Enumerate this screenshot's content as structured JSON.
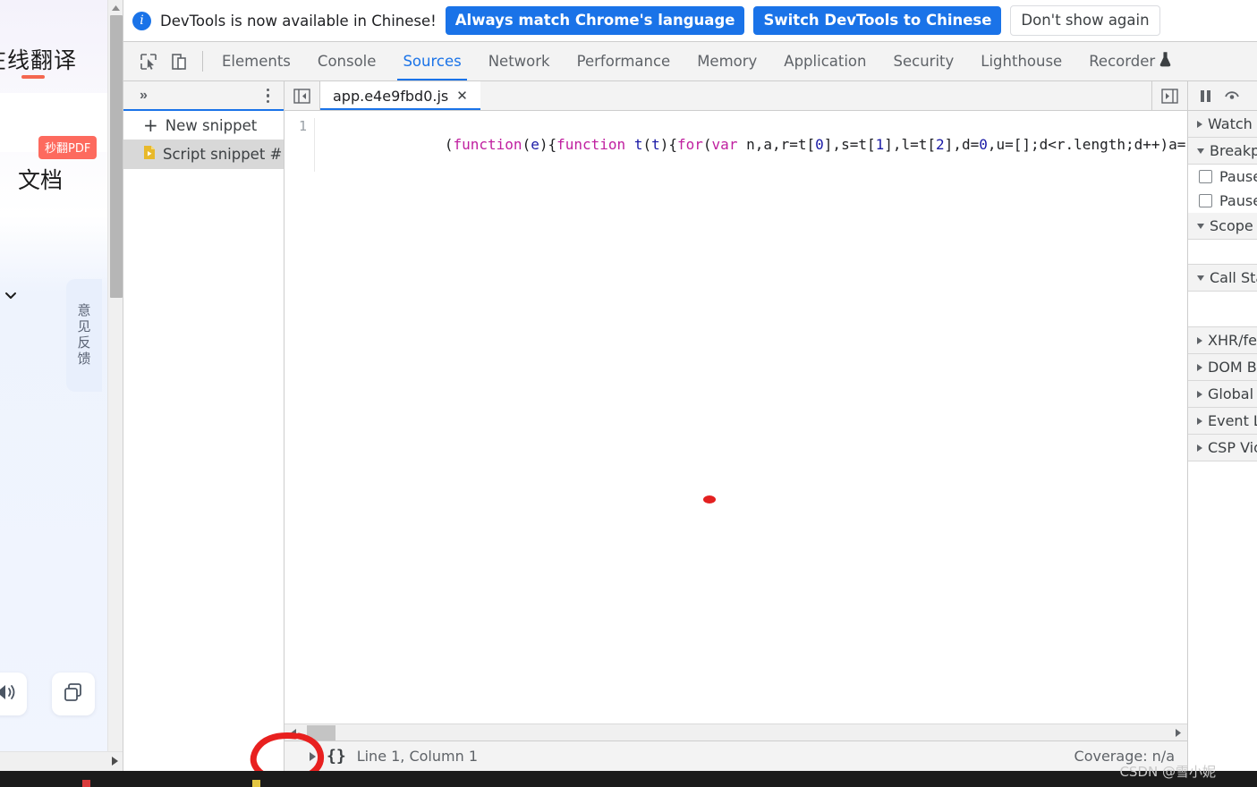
{
  "page_behind": {
    "title": "在线翻译",
    "badge": "秒翻PDF",
    "doc_label": "文档",
    "feedback_label": "意见反馈",
    "speaker_icon": "speaker-icon",
    "copy_icon": "copy-icon",
    "chevron_icon": "chevron-down-icon"
  },
  "devtools": {
    "banner": {
      "info_icon": "info-icon",
      "message": "DevTools is now available in Chinese!",
      "primary_action": "Always match Chrome's language",
      "secondary_action": "Switch DevTools to Chinese",
      "dismiss_action": "Don't show again"
    },
    "toolbar_icons": [
      {
        "name": "inspect-element-icon"
      },
      {
        "name": "device-toolbar-icon"
      }
    ],
    "tabs": [
      {
        "label": "Elements",
        "active": false
      },
      {
        "label": "Console",
        "active": false
      },
      {
        "label": "Sources",
        "active": true
      },
      {
        "label": "Network",
        "active": false
      },
      {
        "label": "Performance",
        "active": false
      },
      {
        "label": "Memory",
        "active": false
      },
      {
        "label": "Application",
        "active": false
      },
      {
        "label": "Security",
        "active": false
      },
      {
        "label": "Lighthouse",
        "active": false
      },
      {
        "label": "Recorder",
        "active": false,
        "icon": "flask-experiment-icon"
      }
    ],
    "navigator": {
      "more_tabs_icon": "chevron-double-right-icon",
      "menu_icon": "kebab-menu-icon",
      "new_snippet": "New snippet",
      "snippet_item": "Script snippet #",
      "snippet_file_icon": "script-file-icon"
    },
    "editor": {
      "sidebar_toggle_icon": "collapse-sidebar-icon",
      "right_toggle_icon": "expand-sidebar-icon",
      "file_tab": "app.e4e9fbd0.js",
      "close_icon": "close-icon",
      "line_number": "1",
      "code_tokens": [
        {
          "t": "(",
          "c": "plain"
        },
        {
          "t": "function",
          "c": "kw"
        },
        {
          "t": "(",
          "c": "plain"
        },
        {
          "t": "e",
          "c": "var"
        },
        {
          "t": "){",
          "c": "plain"
        },
        {
          "t": "function",
          "c": "kw"
        },
        {
          "t": " ",
          "c": "plain"
        },
        {
          "t": "t",
          "c": "var"
        },
        {
          "t": "(",
          "c": "plain"
        },
        {
          "t": "t",
          "c": "var"
        },
        {
          "t": "){",
          "c": "plain"
        },
        {
          "t": "for",
          "c": "kw"
        },
        {
          "t": "(",
          "c": "plain"
        },
        {
          "t": "var",
          "c": "kw"
        },
        {
          "t": " n,a,r=t[",
          "c": "plain"
        },
        {
          "t": "0",
          "c": "num"
        },
        {
          "t": "],s=t[",
          "c": "plain"
        },
        {
          "t": "1",
          "c": "num"
        },
        {
          "t": "],l=t[",
          "c": "plain"
        },
        {
          "t": "2",
          "c": "num"
        },
        {
          "t": "],d=",
          "c": "plain"
        },
        {
          "t": "0",
          "c": "num"
        },
        {
          "t": ",u=[];d<r.length;d++)a=r[d],Obje",
          "c": "plain"
        }
      ],
      "code_plain": "(function(e){function t(t){for(var n,a,r=t[0],s=t[1],l=t[2],d=0,u=[];d<r.length;d++)a=r[d],Obje"
    },
    "status_bar": {
      "expand_icon": "triangle-right-icon",
      "pretty_print": "{}",
      "position": "Line 1, Column 1",
      "coverage": "Coverage: n/a"
    },
    "debugger": {
      "pause_icon": "pause-script-icon",
      "step_over_icon": "step-over-icon",
      "sections": [
        {
          "label": "Watch",
          "open": false,
          "body": "none"
        },
        {
          "label": "Breakpoints",
          "open": true,
          "body": "checkboxes"
        },
        {
          "label": "Scope",
          "open": true,
          "body": "empty"
        },
        {
          "label": "Call Stack",
          "open": true,
          "body": "empty"
        },
        {
          "label": "XHR/fetch Breakpoints",
          "open": false,
          "body": "none"
        },
        {
          "label": "DOM Breakpoints",
          "open": false,
          "body": "none"
        },
        {
          "label": "Global Listeners",
          "open": false,
          "body": "none"
        },
        {
          "label": "Event Listener Breakpoints",
          "open": false,
          "body": "none"
        },
        {
          "label": "CSP Violation Breakpoints",
          "open": false,
          "body": "none"
        }
      ],
      "breakpoint_options": [
        "Pause on uncaught exceptions",
        "Pause on caught exceptions"
      ]
    }
  },
  "annotation": {
    "color": "#e8201f",
    "shape": "hand-drawn-ellipse"
  },
  "watermark": "CSDN @雪小妮",
  "colors": {
    "accent": "#1a73e8",
    "toolbar_bg": "#f3f3f3",
    "border": "#cdcdcd",
    "annotation_red": "#e8201f",
    "badge_red": "#fd6a5e"
  }
}
